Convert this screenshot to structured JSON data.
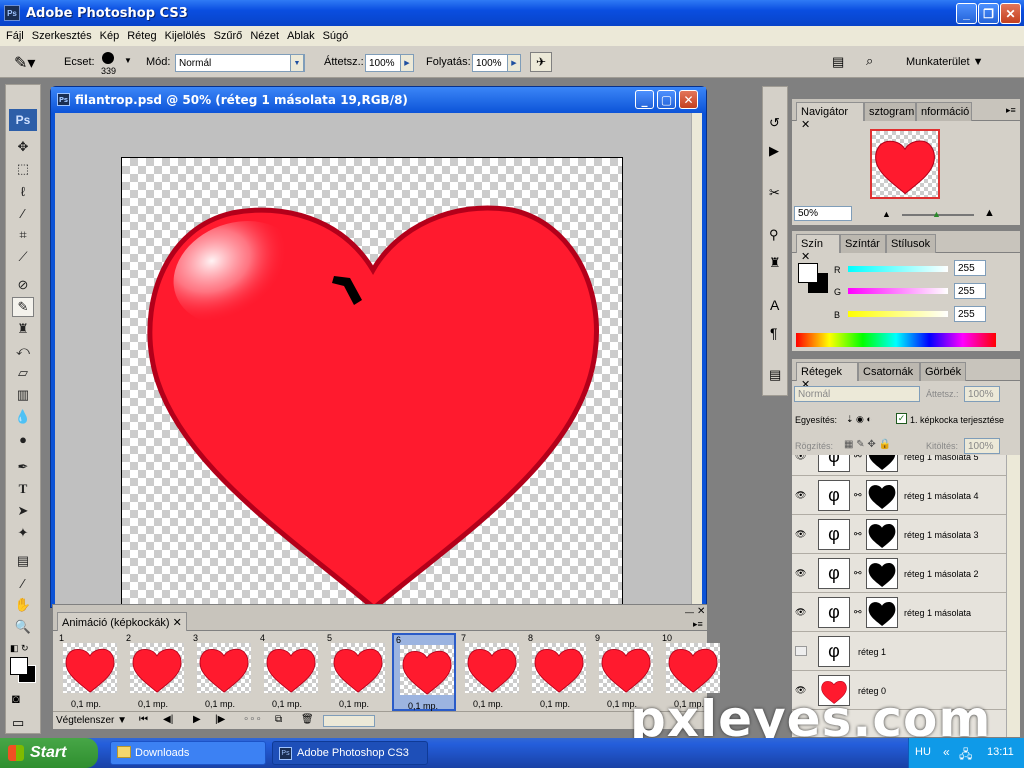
{
  "app": {
    "title": "Adobe Photoshop CS3",
    "icon_text": "Ps"
  },
  "menu": [
    "Fájl",
    "Szerkesztés",
    "Kép",
    "Réteg",
    "Kijelölés",
    "Szűrő",
    "Nézet",
    "Ablak",
    "Súgó"
  ],
  "options": {
    "brush_label": "Ecset:",
    "brush_size": "339",
    "mode_label": "Mód:",
    "mode_value": "Normál",
    "opacity_label": "Áttetsz.:",
    "opacity_value": "100%",
    "flow_label": "Folyatás:",
    "flow_value": "100%",
    "workspace_label": "Munkaterület"
  },
  "document": {
    "title": "filantrop.psd @ 50% (réteg 1 másolata 19,RGB/8)"
  },
  "animation": {
    "tab": "Animáció (képkockák)",
    "loop": "Végtelenszer",
    "frames": [
      {
        "num": "1",
        "dur": "0,1 mp."
      },
      {
        "num": "2",
        "dur": "0,1 mp."
      },
      {
        "num": "3",
        "dur": "0,1 mp."
      },
      {
        "num": "4",
        "dur": "0,1 mp."
      },
      {
        "num": "5",
        "dur": "0,1 mp."
      },
      {
        "num": "6",
        "dur": "0,1 mp."
      },
      {
        "num": "7",
        "dur": "0,1 mp."
      },
      {
        "num": "8",
        "dur": "0,1 mp."
      },
      {
        "num": "9",
        "dur": "0,1 mp."
      },
      {
        "num": "10",
        "dur": "0,1 mp."
      }
    ]
  },
  "navigator": {
    "tabs": [
      "Navigátor",
      "sztogram",
      "nformáció"
    ],
    "zoom": "50%"
  },
  "color": {
    "tabs": [
      "Szín",
      "Színtár",
      "Stílusok"
    ],
    "r_label": "R",
    "g_label": "G",
    "b_label": "B",
    "r": "255",
    "g": "255",
    "b": "255"
  },
  "layers": {
    "tabs": [
      "Rétegek",
      "Csatornák",
      "Görbék"
    ],
    "blend": "Normál",
    "opacity_label": "Áttetsz.:",
    "opacity": "100%",
    "unify_label": "Egyesítés:",
    "propagate_label": "1. képkocka terjesztése",
    "lock_label": "Rögzítés:",
    "fill_label": "Kitöltés:",
    "fill": "100%",
    "rows": [
      {
        "name": "réteg 1 másolata 5"
      },
      {
        "name": "réteg 1 másolata 4"
      },
      {
        "name": "réteg 1 másolata 3"
      },
      {
        "name": "réteg 1 másolata 2"
      },
      {
        "name": "réteg 1 másolata"
      },
      {
        "name": "réteg 1"
      },
      {
        "name": "réteg 0"
      }
    ]
  },
  "taskbar": {
    "start": "Start",
    "items": [
      "Downloads",
      "Adobe Photoshop CS3"
    ],
    "lang": "HU",
    "time": "13:11"
  },
  "watermark": "pxleyes.com"
}
